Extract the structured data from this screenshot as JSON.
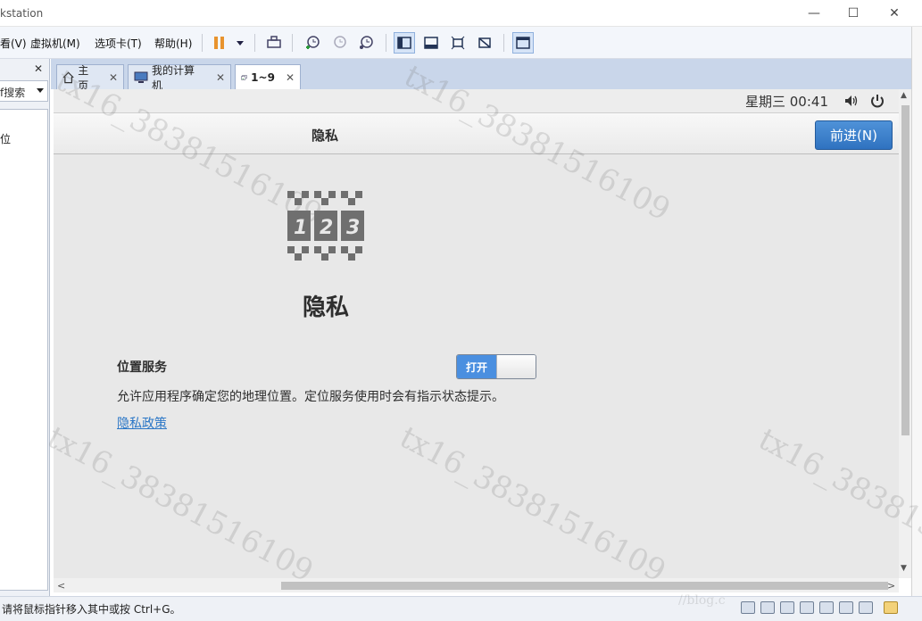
{
  "window": {
    "title": "kstation",
    "minimize": "—",
    "maximize": "☐",
    "close": "✕"
  },
  "menubar": {
    "items": [
      {
        "label": "看(V)"
      },
      {
        "label": "虚拟机(M)"
      },
      {
        "label": "选项卡(T)"
      },
      {
        "label": "帮助(H)"
      }
    ]
  },
  "library": {
    "close": "✕",
    "search_text": "f搜索",
    "tree_item": "位"
  },
  "tabs": [
    {
      "label": "主页",
      "icon": "home-icon"
    },
    {
      "label": "我的计算机",
      "icon": "computer-icon"
    },
    {
      "label": "1~9",
      "icon": "vm-icon",
      "active": true
    }
  ],
  "tab_close": "✕",
  "guest": {
    "clock": "星期三 00:41",
    "header_title": "隐私",
    "next_button": "前进(N)",
    "big_title": "隐私",
    "location_label": "位置服务",
    "toggle_on_label": "打开",
    "toggle_state": "on",
    "description": "允许应用程序确定您的地理位置。定位服务使用时会有指示状态提示。",
    "policy_link": "隐私政策"
  },
  "scroll": {
    "up": "▲",
    "down": "▼",
    "left": "<",
    "right": ">"
  },
  "statusbar": {
    "text": "请将鼠标指针移入其中或按 Ctrl+G。"
  },
  "watermark": {
    "text": "tx16_38381516109",
    "url_text": "//blog.c"
  },
  "colors": {
    "accent": "#2f72c0",
    "toggle_on": "#4a8fe0",
    "link": "#2a76c6"
  }
}
